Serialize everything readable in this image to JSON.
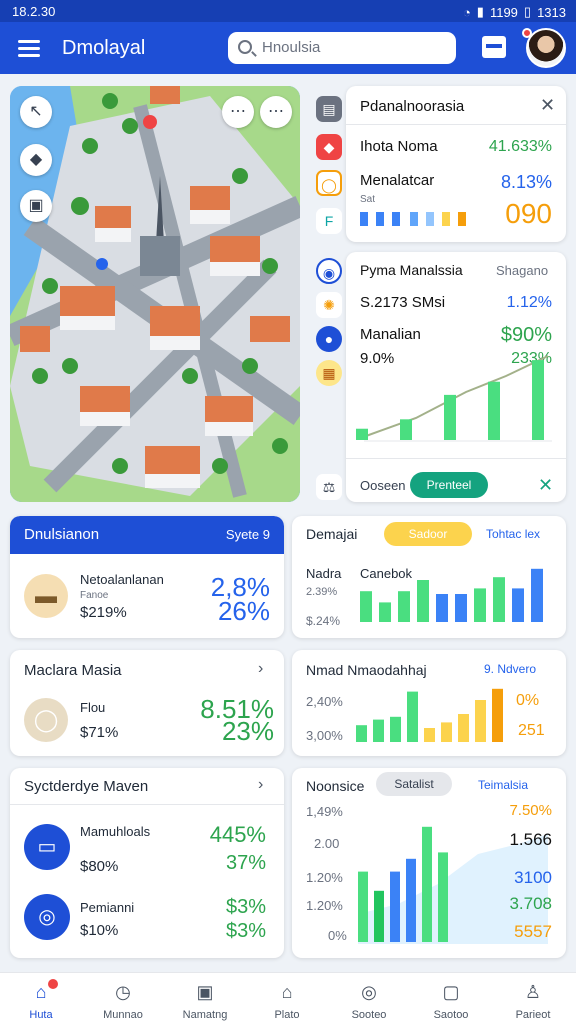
{
  "status": {
    "time": "18.2.30",
    "battery": "1313",
    "signal_text": "1199"
  },
  "appbar": {
    "title": "Dmolayal",
    "search_placeholder": "Hnoulsia"
  },
  "map": {
    "locate_label": "↖",
    "dots_label": "⋯",
    "more_label": "⋯"
  },
  "panel1": {
    "title": "Pdanalnoorasia",
    "rows": [
      {
        "label": "Ihota Noma",
        "value": "41.633%"
      },
      {
        "label": "Menalatcar",
        "value": "8.13%"
      },
      {
        "label": "Sat",
        "value": "090"
      }
    ]
  },
  "panel2": {
    "title": "Pyma Manalssia",
    "tag": "Shagano",
    "rows": [
      {
        "label": "S.2173 SMsi",
        "value": "1.12%"
      },
      {
        "label": "Manalian",
        "value": "$90%"
      },
      {
        "label": "9.0%",
        "value": "233%"
      }
    ],
    "bars": [
      0.12,
      0.22,
      0.48,
      0.62,
      0.85
    ],
    "footer_label": "Ooseen",
    "footer_button": "Prenteel"
  },
  "card_a": {
    "header": "Dnulsianon",
    "header_right": "Syete 9",
    "name": "Netoalanlanan",
    "sub": "Fanoe",
    "price": "$219%",
    "big1": "2,8%",
    "big2": "26%"
  },
  "card_b": {
    "title": "Demajai",
    "pill": "Sadoor",
    "link": "Tohtac lex",
    "label1": "Nadra",
    "label2": "Canebok",
    "value1": "2.39%",
    "value2": "$.24%",
    "bars": [
      {
        "v": 0.55,
        "c": "#4ade80"
      },
      {
        "v": 0.35,
        "c": "#4ade80"
      },
      {
        "v": 0.55,
        "c": "#4ade80"
      },
      {
        "v": 0.75,
        "c": "#4ade80"
      },
      {
        "v": 0.5,
        "c": "#3b82f6"
      },
      {
        "v": 0.5,
        "c": "#3b82f6"
      },
      {
        "v": 0.6,
        "c": "#4ade80"
      },
      {
        "v": 0.8,
        "c": "#4ade80"
      },
      {
        "v": 0.6,
        "c": "#3b82f6"
      },
      {
        "v": 0.95,
        "c": "#3b82f6"
      }
    ]
  },
  "card_c": {
    "title": "Maclara Masia",
    "name": "Flou",
    "price": "$71%",
    "big1": "8.51%",
    "big2": "23%"
  },
  "card_d": {
    "title": "Nmad Nmaodahhaj",
    "link": "9. Ndvero",
    "value1": "2,40%",
    "value2": "3,00%",
    "right1": "0%",
    "right2": "251",
    "bars": [
      {
        "v": 0.3,
        "c": "#4ade80"
      },
      {
        "v": 0.4,
        "c": "#4ade80"
      },
      {
        "v": 0.45,
        "c": "#4ade80"
      },
      {
        "v": 0.9,
        "c": "#4ade80"
      },
      {
        "v": 0.25,
        "c": "#fcd34d"
      },
      {
        "v": 0.35,
        "c": "#fcd34d"
      },
      {
        "v": 0.5,
        "c": "#fcd34d"
      },
      {
        "v": 0.75,
        "c": "#fcd34d"
      },
      {
        "v": 0.95,
        "c": "#f59e0b"
      }
    ]
  },
  "card_e": {
    "title": "Syctderdye Maven",
    "item1_name": "Mamuhloals",
    "item1_price": "$80%",
    "item1_big1": "445%",
    "item1_big2": "37%",
    "item2_name": "Pemianni",
    "item2_price": "$10%",
    "item2_big1": "$3%",
    "item2_big2": "$3%"
  },
  "card_f": {
    "title": "Noonsice",
    "pill": "Satalist",
    "link": "Teimalsia",
    "yticks": [
      "1,49%",
      "2.00",
      "1.20%",
      "1.20%",
      "0%"
    ],
    "right": [
      "7.50%",
      "1.566",
      "3100",
      "3.708",
      "5557"
    ],
    "bars": [
      {
        "v": 0.55,
        "c": "#4ade80"
      },
      {
        "v": 0.4,
        "c": "#22c55e"
      },
      {
        "v": 0.55,
        "c": "#3b82f6"
      },
      {
        "v": 0.65,
        "c": "#3b82f6"
      },
      {
        "v": 0.9,
        "c": "#4ade80"
      },
      {
        "v": 0.7,
        "c": "#4ade80"
      }
    ]
  },
  "bottom_nav": [
    {
      "label": "Huta",
      "icon": "home-icon",
      "active": true
    },
    {
      "label": "Munnao",
      "icon": "clock-icon",
      "active": false
    },
    {
      "label": "Namatng",
      "icon": "calendar-icon",
      "active": false
    },
    {
      "label": "Plato",
      "icon": "house-icon",
      "active": false
    },
    {
      "label": "Sooteo",
      "icon": "badge-icon",
      "active": false
    },
    {
      "label": "Saotoo",
      "icon": "chat-icon",
      "active": false
    },
    {
      "label": "Parieot",
      "icon": "person-icon",
      "active": false
    }
  ],
  "colors": {
    "primary": "#1e4fd6",
    "green": "#2da44e",
    "blue": "#2563eb",
    "orange": "#f59e0b"
  }
}
